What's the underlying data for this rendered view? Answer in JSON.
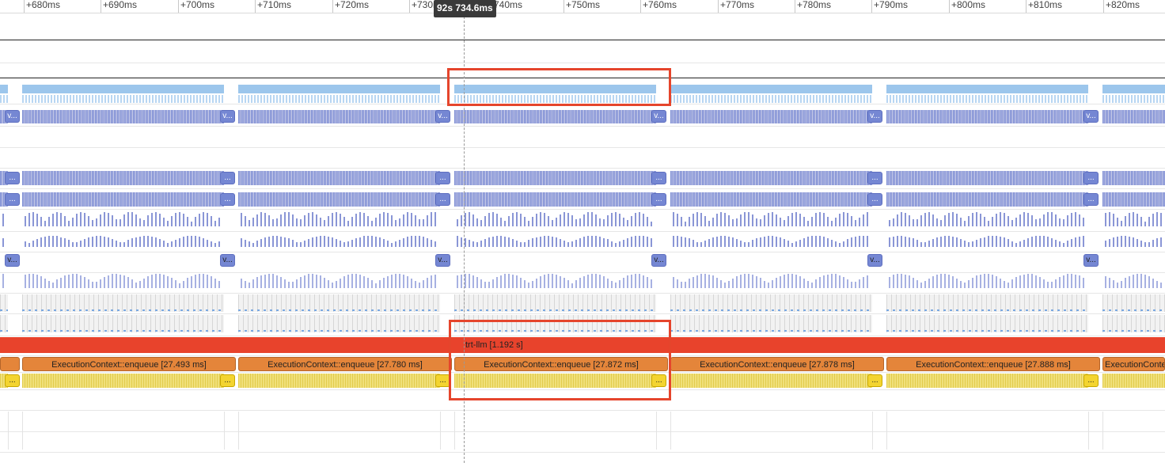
{
  "ruler": {
    "ticks": [
      "+680ms",
      "+690ms",
      "+700ms",
      "+710ms",
      "+720ms",
      "+730ms",
      "+740ms",
      "+750ms",
      "+760ms",
      "+770ms",
      "+780ms",
      "+790ms",
      "+800ms",
      "+810ms",
      "+820ms"
    ],
    "cursor_label": "92s 734.6ms"
  },
  "tracks": {
    "trt_llm": {
      "label": "trt-llm [1.192 s]",
      "color": "#e8432c"
    },
    "enqueue": {
      "first_clipped": "",
      "labels": [
        "ExecutionContext::enqueue [27.493 ms]",
        "ExecutionContext::enqueue [27.780 ms]",
        "ExecutionContext::enqueue [27.872 ms]",
        "ExecutionContext::enqueue [27.878 ms]",
        "ExecutionContext::enqueue [27.888 ms]",
        "ExecutionContext..."
      ],
      "color": "#e4853a"
    },
    "chip_ellipsis": "...",
    "chip_v": "v...",
    "colors": {
      "light_blue": "#9cc6ec",
      "kernel_blue": "#8a96d6",
      "chip_blue": "#7587d3",
      "yellow": "#ecd65c",
      "chip_yellow": "#f3d430"
    }
  },
  "annotations": {
    "highlight_color": "#e5452c"
  }
}
